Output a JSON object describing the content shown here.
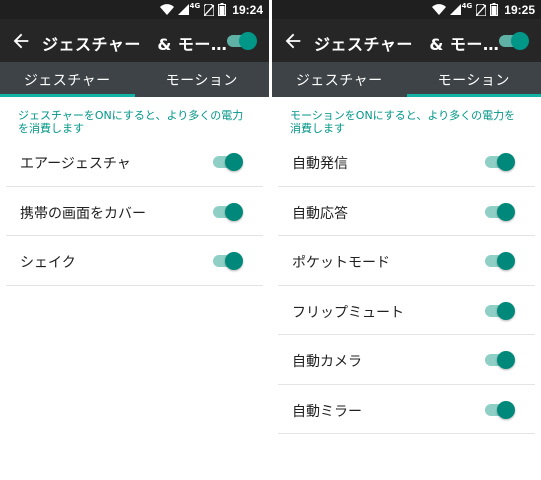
{
  "left": {
    "status": {
      "time": "19:24",
      "network": "4G"
    },
    "toolbar": {
      "title": "ジェスチャー　& モー…",
      "back_icon": "arrow-back-icon",
      "master_switch_on": true
    },
    "tabs": [
      {
        "label": "ジェスチャー",
        "active": true
      },
      {
        "label": "モーション",
        "active": false
      }
    ],
    "description": "ジェスチャーをONにすると、より多くの電力を消費します",
    "items": [
      {
        "label": "エアージェスチャ",
        "on": true
      },
      {
        "label": "携帯の画面をカバー",
        "on": true
      },
      {
        "label": "シェイク",
        "on": true
      }
    ]
  },
  "right": {
    "status": {
      "time": "19:25",
      "network": "4G"
    },
    "toolbar": {
      "title": "ジェスチャー　& モー…",
      "back_icon": "arrow-back-icon",
      "master_switch_on": true
    },
    "tabs": [
      {
        "label": "ジェスチャー",
        "active": false
      },
      {
        "label": "モーション",
        "active": true
      }
    ],
    "description": "モーションをONにすると、より多くの電力を消費します",
    "items": [
      {
        "label": "自動発信",
        "on": true
      },
      {
        "label": "自動応答",
        "on": true
      },
      {
        "label": "ポケットモード",
        "on": true
      },
      {
        "label": "フリップミュート",
        "on": true
      },
      {
        "label": "自動カメラ",
        "on": true
      },
      {
        "label": "自動ミラー",
        "on": true
      }
    ]
  },
  "colors": {
    "accent": "#009688",
    "toolbar": "#262626",
    "tabs": "#3d4347",
    "statusbar": "#1f1f1f"
  }
}
